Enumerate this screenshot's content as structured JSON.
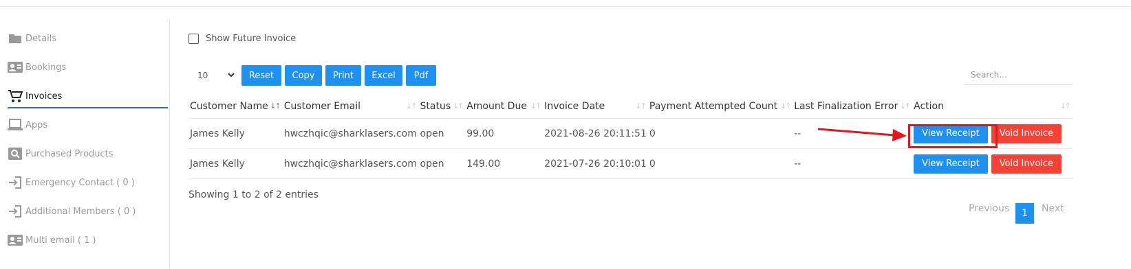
{
  "sidebar": {
    "items": [
      {
        "label": "Details",
        "icon": "folder-icon"
      },
      {
        "label": "Bookings",
        "icon": "contact-card-icon"
      },
      {
        "label": "Invoices",
        "icon": "cart-icon"
      },
      {
        "label": "Apps",
        "icon": "laptop-icon"
      },
      {
        "label": "Purchased Products",
        "icon": "search-box-icon"
      },
      {
        "label": "Emergency Contact ( 0 )",
        "icon": "sign-in-icon"
      },
      {
        "label": "Additional Members ( 0 )",
        "icon": "sign-in-icon"
      },
      {
        "label": "Multi email ( 1 )",
        "icon": "contact-card-icon"
      }
    ],
    "active": "Invoices"
  },
  "filters": {
    "show_future_label": "Show Future Invoice",
    "page_size": "10"
  },
  "toolbar": {
    "reset": "Reset",
    "copy": "Copy",
    "print": "Print",
    "excel": "Excel",
    "pdf": "Pdf"
  },
  "search": {
    "placeholder": "Search..."
  },
  "table": {
    "headers": [
      "Customer Name",
      "Customer Email",
      "Status",
      "Amount Due",
      "Invoice Date",
      "Payment Attempted Count",
      "Last Finalization Error",
      "Action"
    ],
    "rows": [
      {
        "name": "James Kelly",
        "email": "hwczhqic@sharklasers.com",
        "status": "open",
        "amount": "99.00",
        "date": "2021-08-26 20:11:51",
        "attempts": "0",
        "error": "--"
      },
      {
        "name": "James Kelly",
        "email": "hwczhqic@sharklasers.com",
        "status": "open",
        "amount": "149.00",
        "date": "2021-07-26 20:10:01",
        "attempts": "0",
        "error": "--"
      }
    ],
    "view_label": "View Receipt",
    "void_label": "Void Invoice"
  },
  "info": "Showing 1 to 2 of 2 entries",
  "pagination": {
    "previous": "Previous",
    "current": "1",
    "next": "Next"
  },
  "colors": {
    "primary": "#1e90ef",
    "danger": "#f44336",
    "annotation": "#e8141c"
  }
}
